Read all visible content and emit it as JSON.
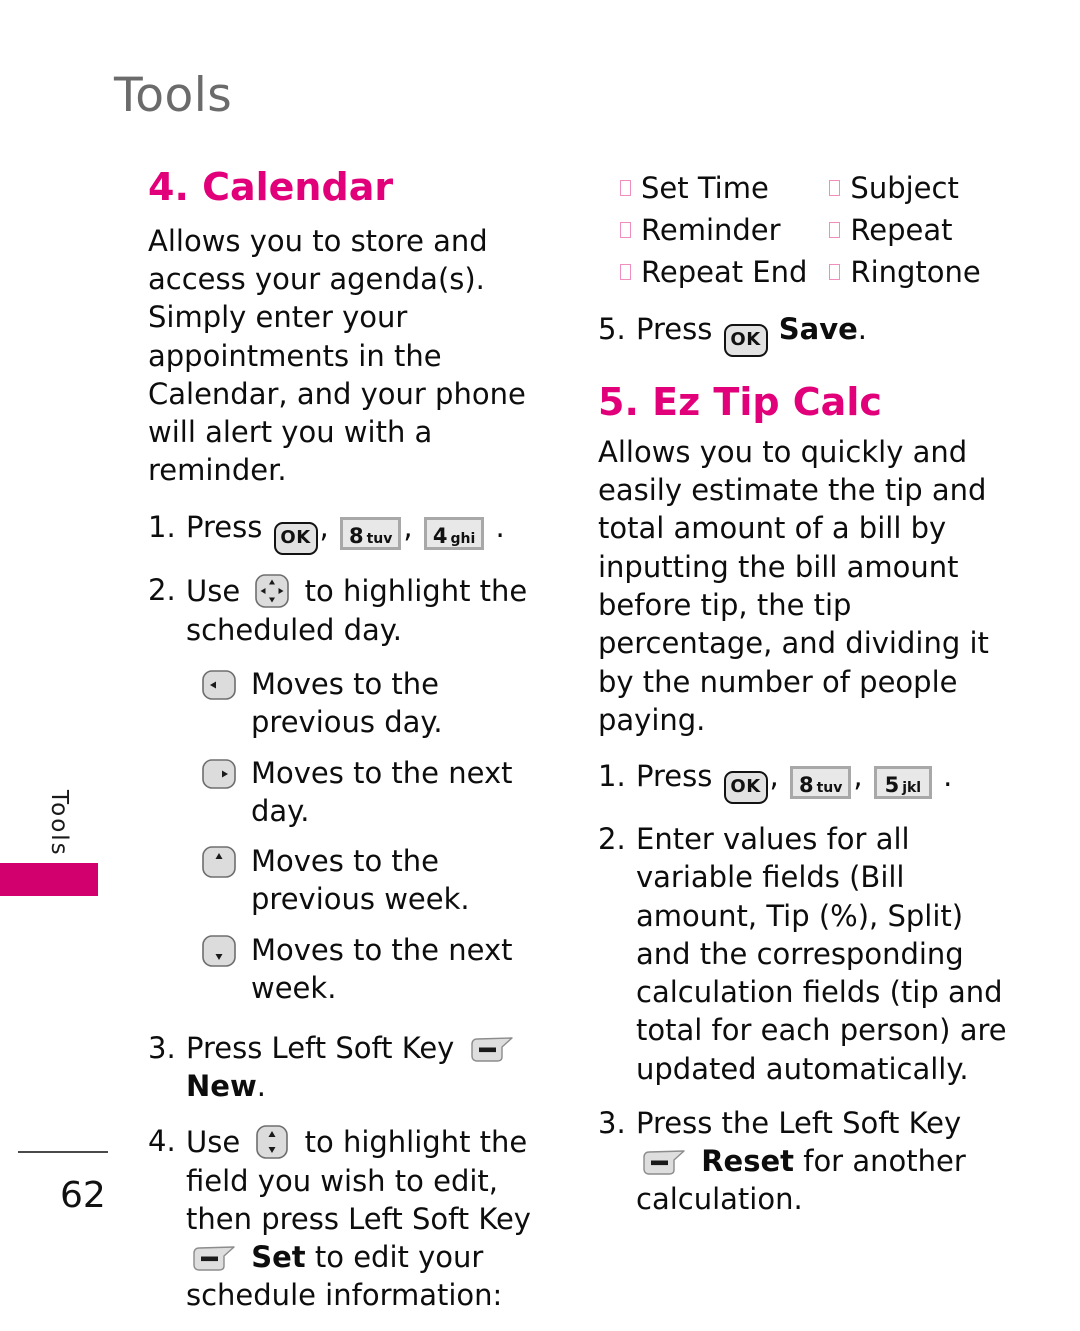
{
  "header": {
    "title": "Tools"
  },
  "side_tab": {
    "label": "Tools",
    "color": "#d1006e"
  },
  "footer": {
    "page_number": "62"
  },
  "colors": {
    "accent_magenta": "#e2007a",
    "tab_magenta": "#d1006e",
    "bullet_pink": "#ef8fc0",
    "header_gray": "#6b6b6b"
  },
  "left_column": {
    "section": {
      "title": "4. Calendar",
      "intro": "Allows you to store and access your agenda(s). Simply enter your appointments in the Calendar, and your phone will alert you with a reminder."
    },
    "step1": {
      "number": "1.",
      "press_label": "Press",
      "keys": [
        {
          "type": "ok",
          "label": "OK"
        },
        {
          "type": "num",
          "digit": "8",
          "letters": "tuv"
        },
        {
          "type": "num",
          "digit": "4",
          "letters": "ghi"
        }
      ],
      "trailing": "."
    },
    "step2": {
      "number": "2.",
      "text_before": "Use",
      "text_after": "to highlight the scheduled day.",
      "nav_key": "four-way-navigation-key"
    },
    "sub_items": [
      {
        "key": "left-arrow-key",
        "text": "Moves to the previous day."
      },
      {
        "key": "right-arrow-key",
        "text": "Moves to the next day."
      },
      {
        "key": "up-arrow-key",
        "text": "Moves to the previous week."
      },
      {
        "key": "down-arrow-key",
        "text": "Moves to the next week."
      }
    ],
    "step3": {
      "number": "3.",
      "text_before": "Press Left Soft Key",
      "bold_label": "New",
      "trailing": "."
    },
    "step4": {
      "number": "4.",
      "text_before": "Use",
      "text_mid": "to highlight the field you wish to edit, then press Left Soft Key",
      "bold_label": "Set",
      "text_after": "to edit your schedule information:",
      "nav_key": "up-down-navigation-key"
    }
  },
  "right_column": {
    "bullets": [
      "Set Time",
      "Subject",
      "Reminder",
      "Repeat",
      "Repeat End",
      "Ringtone"
    ],
    "step5": {
      "number": "5.",
      "press_label": "Press",
      "key": {
        "type": "ok",
        "label": "OK"
      },
      "bold_label": "Save",
      "trailing": "."
    },
    "section": {
      "title": "5. Ez Tip Calc",
      "intro": "Allows you to quickly and easily estimate the tip and total amount of a bill by inputting the bill amount before tip, the tip percentage, and dividing it by the number of people paying."
    },
    "step1": {
      "number": "1.",
      "press_label": "Press",
      "keys": [
        {
          "type": "ok",
          "label": "OK"
        },
        {
          "type": "num",
          "digit": "8",
          "letters": "tuv"
        },
        {
          "type": "num",
          "digit": "5",
          "letters": "jkl"
        }
      ],
      "trailing": "."
    },
    "step2": {
      "number": "2.",
      "text": "Enter values for all variable fields (Bill amount, Tip (%), Split) and the corresponding calculation fields (tip and total for each person) are updated automatically."
    },
    "step3": {
      "number": "3.",
      "text_before": "Press the Left Soft Key",
      "bold_label": "Reset",
      "text_after": "for another calculation."
    }
  }
}
